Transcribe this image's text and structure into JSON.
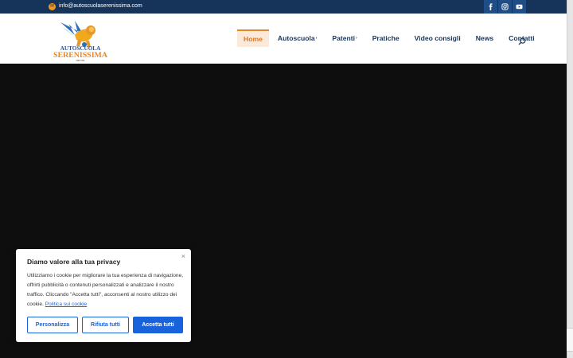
{
  "topbar": {
    "email": "info@autoscuolaserenissima.com",
    "social": [
      "facebook-icon",
      "instagram-icon",
      "youtube-icon"
    ]
  },
  "logo": {
    "line1": "AUTOSCUOLA",
    "line2": "SERENISSIMA",
    "line3": "MESTRE"
  },
  "nav": {
    "items": [
      {
        "label": "Home",
        "active": true,
        "dropdown": false
      },
      {
        "label": "Autoscuola",
        "active": false,
        "dropdown": true
      },
      {
        "label": "Patenti",
        "active": false,
        "dropdown": true
      },
      {
        "label": "Pratiche",
        "active": false,
        "dropdown": false
      },
      {
        "label": "Video consigli",
        "active": false,
        "dropdown": false
      },
      {
        "label": "News",
        "active": false,
        "dropdown": false
      },
      {
        "label": "Contatti",
        "active": false,
        "dropdown": false
      }
    ],
    "chevron": "›"
  },
  "cookie": {
    "close": "×",
    "title": "Diamo valore alla tua privacy",
    "body": "Utilizziamo i cookie per migliorare la tua esperienza di navigazione, offrirti pubblicità o contenuti personalizzati e analizzare il nostro traffico. Cliccando \"Accetta tutti\", acconsenti al nostro utilizzo dei cookie.",
    "policy_link": "Politica sui cookie",
    "buttons": {
      "customize": "Personalizza",
      "reject": "Rifiuta tutti",
      "accept": "Accetta tutti"
    }
  },
  "colors": {
    "topbar": "#16345a",
    "accent_orange": "#e8872a",
    "nav_text": "#16345a",
    "cookie_blue": "#1863dc",
    "hero_bg": "#0e0e0e"
  }
}
